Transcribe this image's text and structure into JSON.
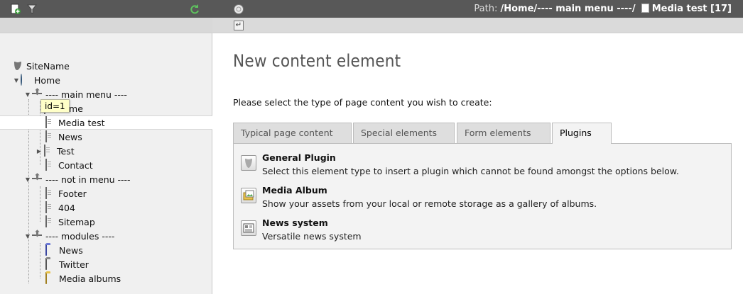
{
  "topbar": {
    "icons": [
      "new-page-icon",
      "filter-icon",
      "refresh-icon",
      "help-icon"
    ],
    "path_label": "Path:",
    "path_value": "/Home/---- main menu ----/",
    "page_title": "Media test [17]"
  },
  "secbar": {
    "return_icon": "return-icon"
  },
  "tree": {
    "root": "SiteName",
    "home": "Home",
    "main_menu": "---- main menu ----",
    "home_sub": "Home",
    "media_test": "Media test",
    "news": "News",
    "test": "Test",
    "contact": "Contact",
    "not_in_menu": "---- not in menu ----",
    "footer": "Footer",
    "p404": "404",
    "sitemap": "Sitemap",
    "modules": "---- modules ----",
    "mod_news": "News",
    "twitter": "Twitter",
    "media_albums": "Media albums",
    "tooltip": "id=1"
  },
  "main": {
    "title": "New content element",
    "prompt": "Please select the type of page content you wish to create:",
    "tabs": [
      {
        "label": "Typical page content"
      },
      {
        "label": "Special elements"
      },
      {
        "label": "Form elements"
      },
      {
        "label": "Plugins"
      }
    ],
    "items": [
      {
        "title": "General Plugin",
        "desc": "Select this element type to insert a plugin which cannot be found amongst the options below."
      },
      {
        "title": "Media Album",
        "desc": "Show your assets from your local or remote storage as a gallery of albums."
      },
      {
        "title": "News system",
        "desc": "Versatile news system"
      }
    ]
  },
  "colors": {
    "topbar": "#585858",
    "folder_blue": "#6b78d6",
    "folder_gray": "#8a8a8a",
    "folder_yellow": "#e8c24a"
  }
}
